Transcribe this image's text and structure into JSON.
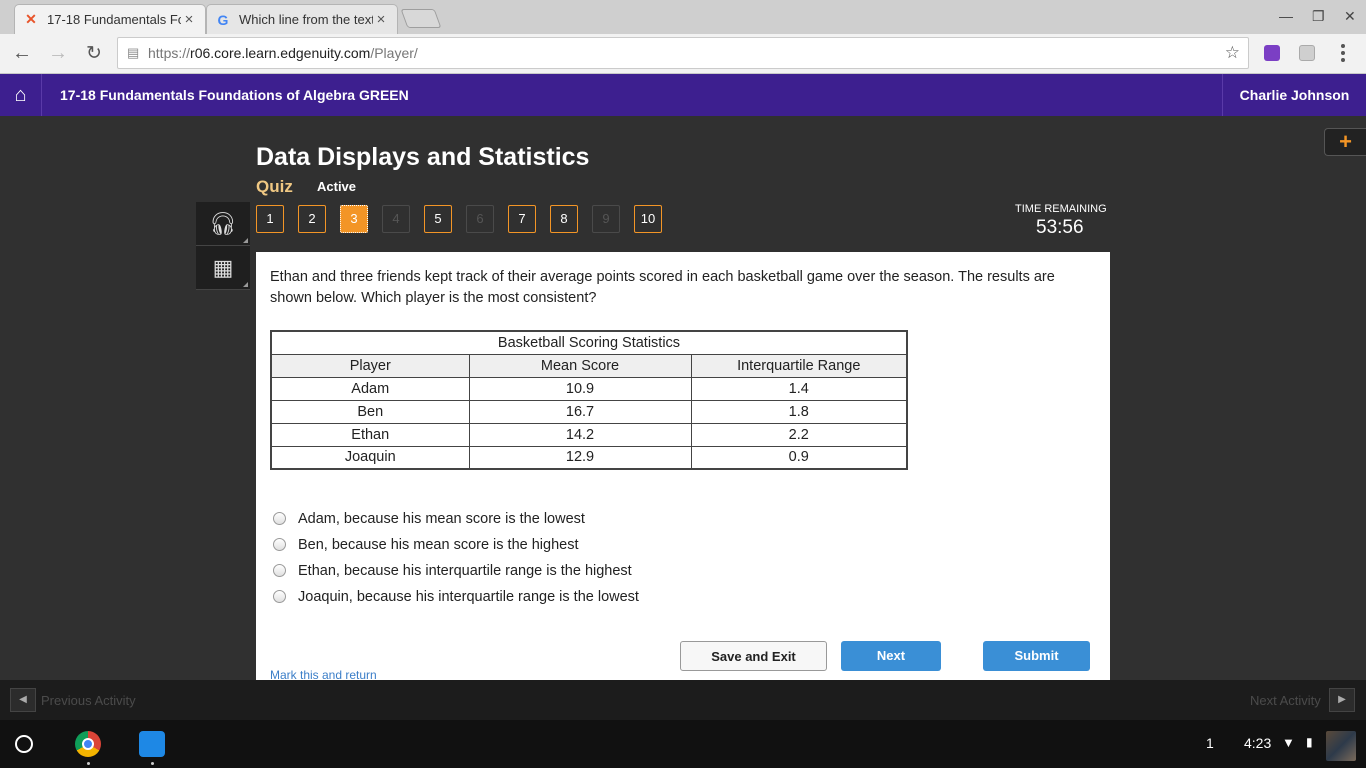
{
  "browser": {
    "tabs": [
      {
        "title": "17-18 Fundamentals Fo",
        "favicon": "edgenuity-x-icon"
      },
      {
        "title": "Which line from the text",
        "favicon": "google-g-icon"
      }
    ],
    "url_prefix": "https://",
    "url_host": "r06.core.learn.edgenuity.com",
    "url_path": "/Player/"
  },
  "header": {
    "course": "17-18 Fundamentals Foundations of Algebra GREEN",
    "user": "Charlie Johnson"
  },
  "lesson": {
    "title": "Data Displays and Statistics",
    "type": "Quiz",
    "status": "Active"
  },
  "questions": {
    "numbers": [
      "1",
      "2",
      "3",
      "4",
      "5",
      "6",
      "7",
      "8",
      "9",
      "10"
    ],
    "current": "3",
    "inactive": [
      "4",
      "6",
      "9"
    ]
  },
  "timer": {
    "label": "TIME REMAINING",
    "value": "53:56"
  },
  "question": {
    "text": "Ethan and three friends kept track of their average points scored in each basketball game over the season. The results are shown below. Which player is the most consistent?",
    "table": {
      "caption": "Basketball Scoring Statistics",
      "headers": [
        "Player",
        "Mean Score",
        "Interquartile Range"
      ],
      "rows": [
        [
          "Adam",
          "10.9",
          "1.4"
        ],
        [
          "Ben",
          "16.7",
          "1.8"
        ],
        [
          "Ethan",
          "14.2",
          "2.2"
        ],
        [
          "Joaquin",
          "12.9",
          "0.9"
        ]
      ]
    },
    "choices": [
      "Adam, because his mean score is the lowest",
      "Ben, because his mean score is the highest",
      "Ethan, because his interquartile range is the highest",
      "Joaquin, because his interquartile range is the lowest"
    ]
  },
  "actions": {
    "mark": "Mark this and return",
    "save_exit": "Save and Exit",
    "next": "Next",
    "submit": "Submit"
  },
  "activity_nav": {
    "previous": "Previous Activity",
    "next": "Next Activity"
  },
  "taskbar": {
    "notifications": "1",
    "clock": "4:23"
  },
  "colors": {
    "header": "#3d1f8f",
    "accent": "#f39526",
    "button_blue": "#3a8fd6"
  }
}
